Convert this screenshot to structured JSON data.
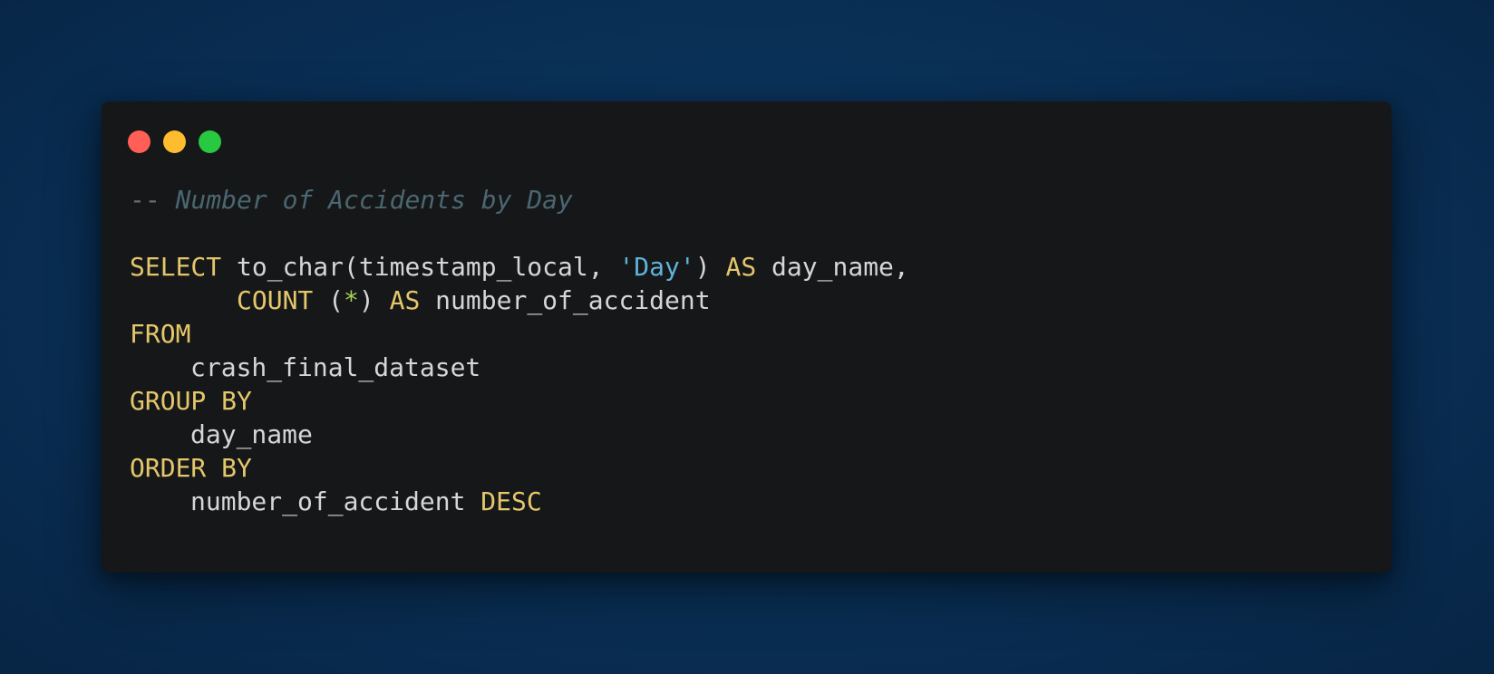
{
  "window_controls": {
    "close_color": "#ff5f57",
    "minimize_color": "#febc2e",
    "maximize_color": "#28c840"
  },
  "colors": {
    "background": "#0a3158",
    "editor_background": "#161719",
    "keyword": "#e5c76b",
    "plain": "#d6d6d6",
    "string": "#5fb3d9",
    "operator": "#a6d15a",
    "comment_dash": "#6b6f73",
    "comment_text": "#4a6670"
  },
  "code": {
    "comment_dashes": "--",
    "comment_text": "Number of Accidents by Day",
    "line1": {
      "kw_select": "SELECT",
      "fn_call": "to_char(timestamp_local, ",
      "string_day": "'Day'",
      "paren_close": ")",
      "kw_as": "AS",
      "alias": "day_name,"
    },
    "line2": {
      "kw_count": "COUNT",
      "paren_open": "(",
      "star": "*",
      "paren_close": ")",
      "kw_as": "AS",
      "alias": "number_of_accident"
    },
    "line3": {
      "kw_from": "FROM"
    },
    "line4": {
      "table": "crash_final_dataset"
    },
    "line5": {
      "kw_group_by": "GROUP BY"
    },
    "line6": {
      "column": "day_name"
    },
    "line7": {
      "kw_order_by": "ORDER BY"
    },
    "line8": {
      "column": "number_of_accident",
      "kw_desc": "DESC"
    }
  }
}
